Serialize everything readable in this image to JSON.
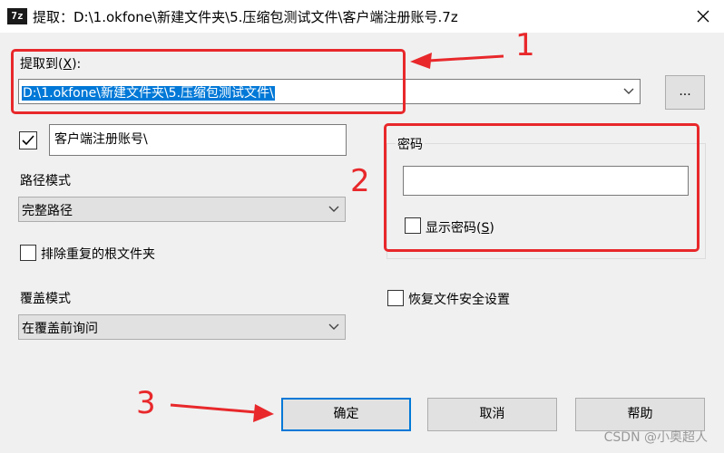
{
  "window": {
    "app_icon_text": "7z",
    "title": "提取：D:\\1.okfone\\新建文件夹\\5.压缩包测试文件\\客户端注册账号.7z"
  },
  "extract_to": {
    "label_prefix": "提取到(",
    "label_key": "X",
    "label_suffix": "):",
    "path_value": "D:\\1.okfone\\新建文件夹\\5.压缩包测试文件\\",
    "browse_label": "..."
  },
  "subfolder": {
    "checked": true,
    "value": "客户端注册账号\\"
  },
  "path_mode": {
    "label": "路径模式",
    "selected": "完整路径"
  },
  "eliminate_root": {
    "label": "排除重复的根文件夹",
    "checked": false
  },
  "overwrite_mode": {
    "label": "覆盖模式",
    "selected": "在覆盖前询问"
  },
  "password": {
    "group_label": "密码",
    "value": "",
    "show_label_prefix": "显示密码(",
    "show_label_key": "S",
    "show_label_suffix": ")",
    "show_checked": false
  },
  "restore_security": {
    "label": "恢复文件安全设置",
    "checked": false
  },
  "buttons": {
    "ok": "确定",
    "cancel": "取消",
    "help": "帮助"
  },
  "annotations": {
    "num1": "1",
    "num2": "2",
    "num3": "3",
    "color": "#e8282b"
  },
  "watermark": "CSDN @小奥超人"
}
